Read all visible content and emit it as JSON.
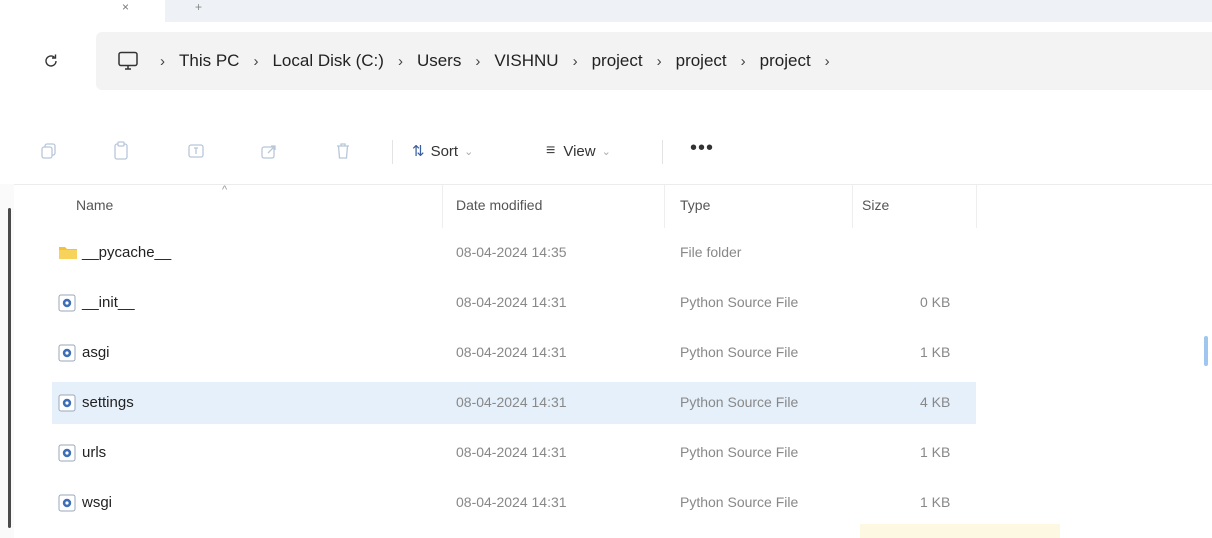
{
  "tabbar": {
    "close_glyph": "×",
    "new_tab_glyph": "+"
  },
  "address": {
    "refresh_icon": "refresh-icon",
    "pc_icon": "computer-icon",
    "separator": "›",
    "crumbs": [
      "This PC",
      "Local Disk (C:)",
      "Users",
      "VISHNU",
      "project",
      "project",
      "project"
    ]
  },
  "command_bar": {
    "icons": [
      "copy-icon",
      "paste-icon",
      "rename-icon",
      "share-icon",
      "delete-icon"
    ],
    "sort_label": "Sort",
    "view_label": "View",
    "more_label": "•••"
  },
  "columns": {
    "name": "Name",
    "date": "Date modified",
    "type": "Type",
    "size": "Size"
  },
  "files": [
    {
      "name": "__pycache__",
      "date": "08-04-2024 14:35",
      "type": "File folder",
      "size": "",
      "kind": "folder"
    },
    {
      "name": "__init__",
      "date": "08-04-2024 14:31",
      "type": "Python Source File",
      "size": "0 KB",
      "kind": "python"
    },
    {
      "name": "asgi",
      "date": "08-04-2024 14:31",
      "type": "Python Source File",
      "size": "1 KB",
      "kind": "python"
    },
    {
      "name": "settings",
      "date": "08-04-2024 14:31",
      "type": "Python Source File",
      "size": "4 KB",
      "kind": "python",
      "selected": true
    },
    {
      "name": "urls",
      "date": "08-04-2024 14:31",
      "type": "Python Source File",
      "size": "1 KB",
      "kind": "python"
    },
    {
      "name": "wsgi",
      "date": "08-04-2024 14:31",
      "type": "Python Source File",
      "size": "1 KB",
      "kind": "python"
    }
  ],
  "colors": {
    "selection": "#e5f0fb",
    "folder": "#f2c23b",
    "python_icon": "#3d6fb6"
  }
}
